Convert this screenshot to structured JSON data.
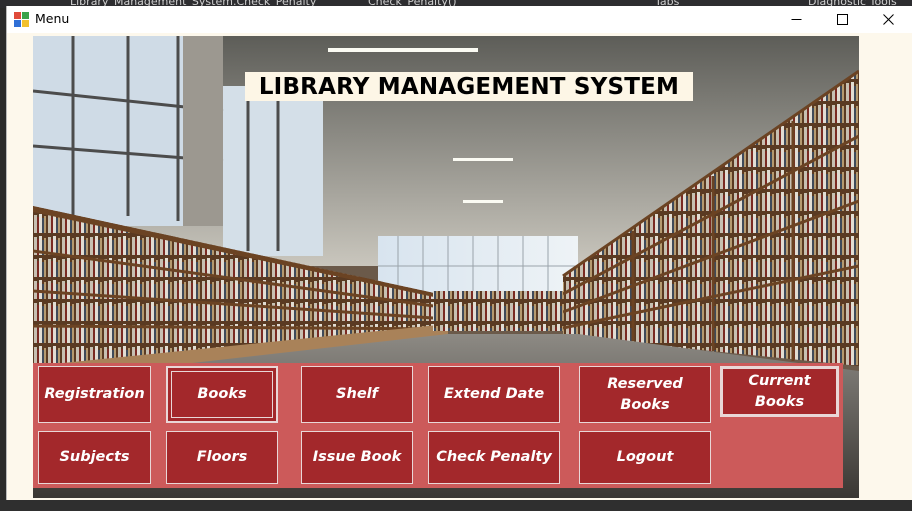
{
  "background_ide": {
    "items": [
      "Library_Management_System.Check_Penalty",
      "Check_Penalty()",
      "Tabs",
      "Diagnostic Tools"
    ]
  },
  "window": {
    "title": "Menu",
    "controls": {
      "minimize": "minimize-icon",
      "maximize": "maximize-icon",
      "close": "close-icon"
    }
  },
  "main": {
    "heading": "LIBRARY MANAGEMENT SYSTEM",
    "buttons_row1": [
      "Registration",
      "Books",
      "Shelf",
      "Extend Date",
      "Reserved Books",
      "Current Books"
    ],
    "buttons_row2": [
      "Subjects",
      "Floors",
      "Issue Book",
      "Check Penalty",
      "Logout"
    ]
  },
  "colors": {
    "button_fill": "#a3282b",
    "button_area": "#cc5a5a",
    "button_border": "#e9d7d7",
    "heading_bg": "#fdf6e6"
  }
}
